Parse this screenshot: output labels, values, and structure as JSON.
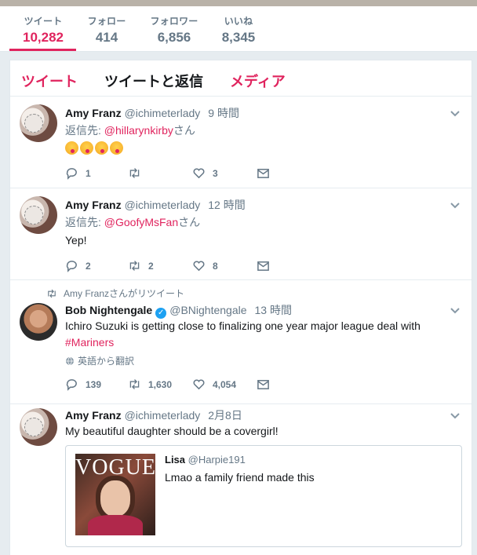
{
  "profile_nav": {
    "stats": [
      {
        "label": "ツイート",
        "value": "10,282"
      },
      {
        "label": "フォロー",
        "value": "414"
      },
      {
        "label": "フォロワー",
        "value": "6,856"
      },
      {
        "label": "いいね",
        "value": "8,345"
      }
    ]
  },
  "tabs": [
    "ツイート",
    "ツイートと返信",
    "メディア"
  ],
  "tweets": [
    {
      "name": "Amy Franz",
      "handle": "@ichimeterlady",
      "time": "9 時間",
      "reply_prefix": "返信先: ",
      "reply_mention": "@hillarynkirby",
      "reply_suffix": "さん",
      "reply_count": "1",
      "retweet_count": "",
      "like_count": "3"
    },
    {
      "name": "Amy Franz",
      "handle": "@ichimeterlady",
      "time": "12 時間",
      "reply_prefix": "返信先: ",
      "reply_mention": "@GoofyMsFan",
      "reply_suffix": "さん",
      "text": "Yep!",
      "reply_count": "2",
      "retweet_count": "2",
      "like_count": "8"
    },
    {
      "retweeted_by": "Amy Franzさんがリツイート",
      "name": "Bob Nightengale",
      "handle": "@BNightengale",
      "time": "13 時間",
      "text": "Ichiro Suzuki is getting close to finalizing one year major league deal with",
      "hashtag": "#Mariners",
      "translate": "英語から翻訳",
      "reply_count": "139",
      "retweet_count": "1,630",
      "like_count": "4,054"
    },
    {
      "name": "Amy Franz",
      "handle": "@ichimeterlady",
      "time": "2月8日",
      "text": "My beautiful daughter should be a covergirl!",
      "quote": {
        "name": "Lisa",
        "handle": "@Harpie191",
        "text": "Lmao a family friend made this",
        "image_title": "VOGUE"
      }
    }
  ],
  "colors": {
    "accent": "#e0245e",
    "muted": "#657786",
    "verified": "#1da1f2"
  }
}
